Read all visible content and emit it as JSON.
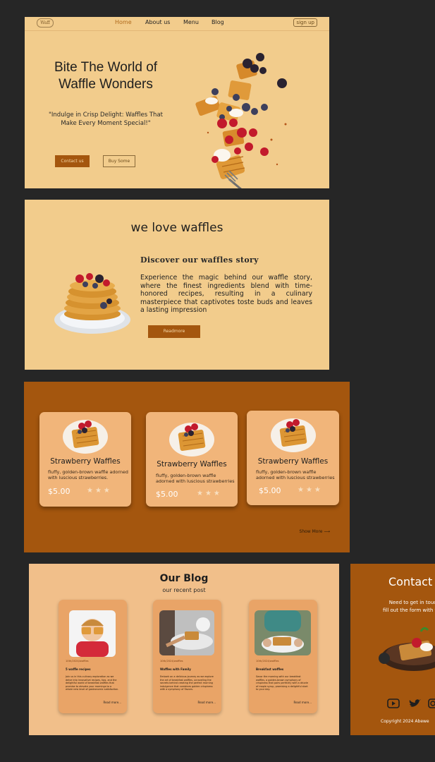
{
  "hero": {
    "logo": "Waff",
    "nav": [
      "Home",
      "About us",
      "Menu",
      "Blog"
    ],
    "signup": "sign up",
    "title_line1": "Bite The World of",
    "title_line2": "Waffle Wonders",
    "subtitle_line1": "\"Indulge in Crisp Delight: Waffles That",
    "subtitle_line2": "Make Every Moment Special!\"",
    "contact_btn": "Contact us",
    "buy_btn": "Buy Some"
  },
  "about": {
    "title": "we love waffles",
    "heading": "Discover our waffles  story",
    "text": "Experience the magic behind our waffle story, where the finest ingredients blend with time-honored recipes, resulting in a culinary masterpiece that captivotes toste buds and leaves a lasting impression",
    "read_more": "Readmore"
  },
  "products": {
    "items": [
      {
        "name": "Strawberry Waffles",
        "desc_line1": "fluffy, golden-brown waffle adorned",
        "desc_line2": "with luscious strawberries.",
        "price": "$5.00",
        "stars": "★★★"
      },
      {
        "name": "Strawberry Waffles",
        "desc_line1": "fluffy, golden-brown waffle",
        "desc_line2": "adorned with luscious strawberries",
        "price": "$5.00",
        "stars": "★★★"
      },
      {
        "name": "Strawberry Waffles",
        "desc_line1": "fluffy, golden-brown waffle",
        "desc_line2": "adorned with luscious strawberries",
        "price": "$5.00",
        "stars": "★★★"
      }
    ],
    "show_more": "Show More ⟶"
  },
  "blog": {
    "title": "Our Blog",
    "subtitle": "our recent post",
    "posts": [
      {
        "date": "10th/2024/waffles",
        "title": "5 waffle recipes",
        "text": "Join us in this culinary exploration as we delve into innovative recipes, tips, and the delightful world of breakfast waffles that promise to elevate your mornings to a whole new level of gastronomic satisfaction.",
        "read": "Read more..."
      },
      {
        "date": "10th/2024/waffles",
        "title": "Waffles with Family",
        "text": "Embark on a delicious journey as we explore the art of breakfast waffles, unraveling the secrets behind creating the perfect morning indulgence that combines golden crispiness with a symphony of flavors.",
        "read": "Read more..."
      },
      {
        "date": "10th/2024/waffles",
        "title": "Breakfast waffles",
        "text": "Savor the morning with our breakfast waffles, a golden-brown symphony of crispiness that pairs perfectly with a drizzle of maple syrup, promising a delightful start to your day.",
        "read": "Read more..."
      }
    ]
  },
  "contact": {
    "title": "Contact Us",
    "line1": "Need to get in touch",
    "line2": "fill out the form with your",
    "copyright": "Copyright  2024  Abewe"
  },
  "colors": {
    "background": "#262626",
    "cream": "#f2cc8c",
    "brand_brown": "#a4560e",
    "card_peach": "#f1b57a"
  }
}
